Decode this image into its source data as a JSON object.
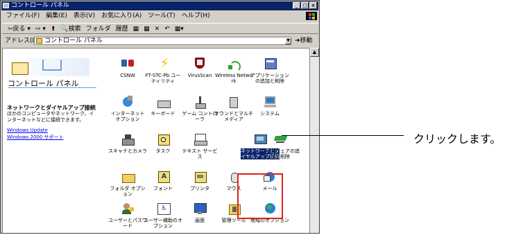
{
  "window": {
    "title": "コントロール パネル",
    "buttons": [
      "_",
      "□",
      "×"
    ]
  },
  "menubar": [
    "ファイル(F)",
    "編集(E)",
    "表示(V)",
    "お気に入り(A)",
    "ツール(T)",
    "ヘルプ(H)"
  ],
  "toolbar": [
    "⇦戻る ▾",
    "⇨ ▾",
    "⬆",
    "🔍検索",
    "フォルダ",
    "履歴",
    "▦",
    "▦",
    "✕",
    "↶",
    "▦▾"
  ],
  "address": {
    "label": "アドレス(D)",
    "value": "コントロール パネル",
    "go": "移動"
  },
  "sidebar": {
    "title": "コントロール パネル",
    "heading": "ネットワークとダイヤルアップ接続",
    "desc": "ほかのコンピュータやネットワーク、インターネットなどに接続できます。",
    "links": [
      "Windows Update",
      "Windows 2000 サポート"
    ]
  },
  "items": [
    {
      "label": "CSNW"
    },
    {
      "label": "FT-STC-Pb ユーティリティ"
    },
    {
      "label": "VirusScan"
    },
    {
      "label": "Wireless Network"
    },
    {
      "label": "アプリケーションの追加と削除"
    },
    {
      "label": "インターネット オプション"
    },
    {
      "label": "キーボード"
    },
    {
      "label": "ゲーム コントローラ"
    },
    {
      "label": "サウンドとマルチメディア"
    },
    {
      "label": "システム"
    },
    {
      "label": "スキャナとカメラ"
    },
    {
      "label": "タスク"
    },
    {
      "label": "テキスト サービス"
    },
    {
      "label": "ネットワークとダイヤルアップ接続"
    },
    {
      "label": "ハードウェアの追加と削除"
    },
    {
      "label": "フォルダ オプション"
    },
    {
      "label": "フォント"
    },
    {
      "label": "プリンタ"
    },
    {
      "label": "マウス"
    },
    {
      "label": "メール"
    },
    {
      "label": "ユーザーとパスワード"
    },
    {
      "label": "ユーザー補助のオプション"
    },
    {
      "label": "画面"
    },
    {
      "label": "管理ツール"
    },
    {
      "label": "地域のオプション"
    }
  ],
  "callout": "クリックします。",
  "colors": {
    "titlebar": "#0a246a",
    "highlight": "#e0221a",
    "link": "#0000ee"
  }
}
